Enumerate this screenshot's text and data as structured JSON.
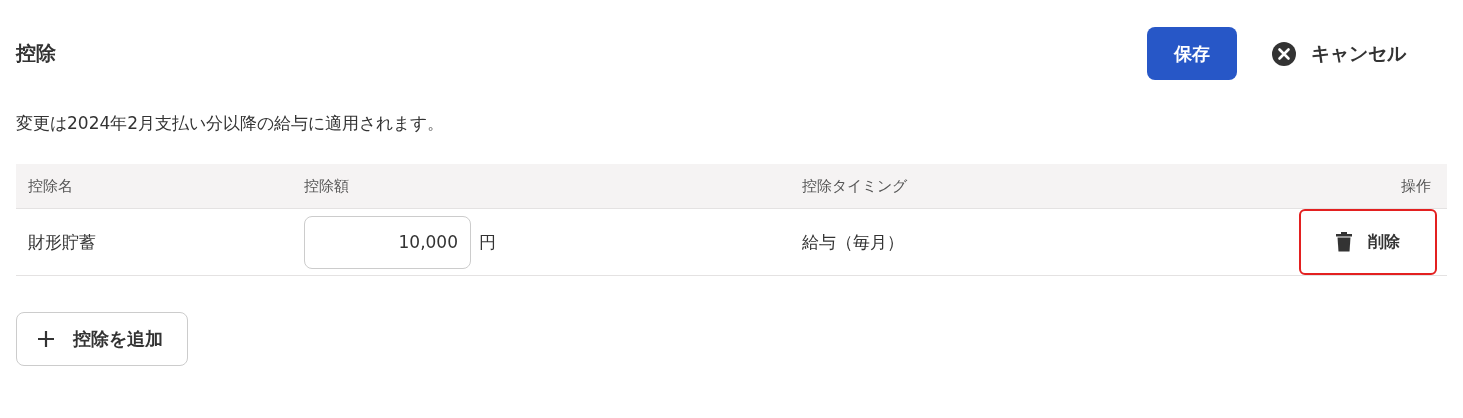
{
  "title": "控除",
  "buttons": {
    "save": "保存",
    "cancel": "キャンセル"
  },
  "notice": "変更は2024年2月支払い分以降の給与に適用されます。",
  "table": {
    "columns": [
      "控除名",
      "控除額",
      "控除タイミング",
      "操作"
    ],
    "rows": [
      {
        "name": "財形貯蓄",
        "amount": "10,000",
        "unit": "円",
        "timing": "給与（毎月）",
        "action": {
          "label": "削除",
          "highlighted": true
        }
      }
    ]
  },
  "add_button": "控除を追加"
}
